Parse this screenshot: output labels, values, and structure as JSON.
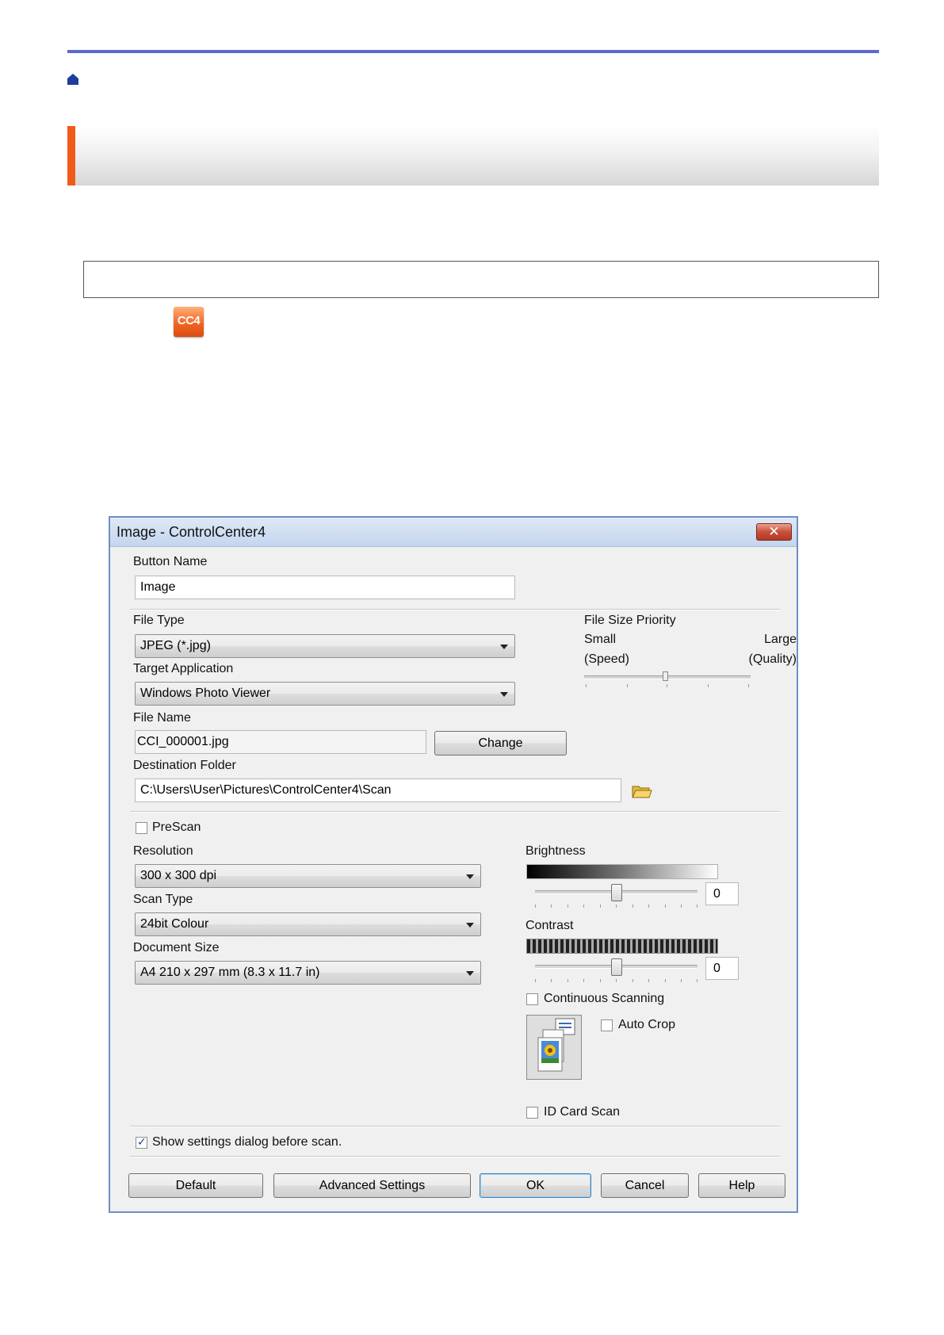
{
  "dialog": {
    "title": "Image - ControlCenter4",
    "close_label": "✕",
    "button_name": {
      "label": "Button Name",
      "value": "Image"
    },
    "file_type": {
      "label": "File Type",
      "value": "JPEG (*.jpg)"
    },
    "target_application": {
      "label": "Target Application",
      "value": "Windows Photo Viewer"
    },
    "file_name": {
      "label": "File Name",
      "value": "CCI_000001.jpg",
      "change_label": "Change"
    },
    "destination_folder": {
      "label": "Destination Folder",
      "value": "C:\\Users\\User\\Pictures\\ControlCenter4\\Scan"
    },
    "file_size_priority": {
      "label": "File Size Priority",
      "small_label": "Small",
      "speed_label": "(Speed)",
      "large_label": "Large",
      "quality_label": "(Quality)",
      "level_fraction": 0.5
    },
    "prescan": {
      "label": "PreScan",
      "checked": false
    },
    "resolution": {
      "label": "Resolution",
      "value": "300 x 300 dpi"
    },
    "scan_type": {
      "label": "Scan Type",
      "value": "24bit Colour"
    },
    "document_size": {
      "label": "Document Size",
      "value": "A4 210 x 297 mm (8.3 x 11.7 in)"
    },
    "brightness": {
      "label": "Brightness",
      "value": "0",
      "level_fraction": 0.5
    },
    "contrast": {
      "label": "Contrast",
      "value": "0",
      "level_fraction": 0.5
    },
    "continuous_scanning": {
      "label": "Continuous Scanning",
      "checked": false
    },
    "auto_crop": {
      "label": "Auto Crop",
      "checked": false
    },
    "id_card_scan": {
      "label": "ID Card Scan",
      "checked": false
    },
    "show_settings": {
      "label": "Show settings dialog before scan.",
      "checked": true
    },
    "buttons": {
      "default_label": "Default",
      "advanced_label": "Advanced Settings",
      "ok_label": "OK",
      "cancel_label": "Cancel",
      "help_label": "Help"
    }
  },
  "app_icon_text": "CC4",
  "colors": {
    "accent_rule": "#5b6ad0",
    "title_accent": "#f05a1a",
    "home_icon": "#1d3d9b"
  }
}
